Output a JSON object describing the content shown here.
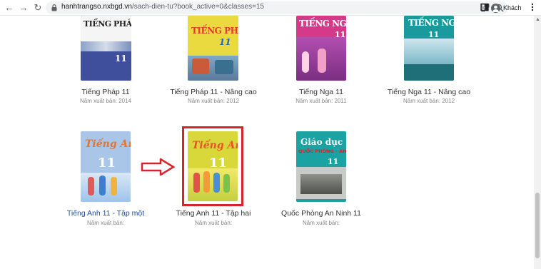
{
  "browser": {
    "url_host": "hanhtrangso.nxbgd.vn",
    "url_path": "/sach-dien-tu?book_active=0&classes=15",
    "profile_label": "Khách"
  },
  "books": [
    {
      "title": "Tiếng Pháp 11",
      "year": "Năm xuất bản: 2014",
      "cover_title": "TIẾNG PHÁP",
      "cover_num": "11"
    },
    {
      "title": "Tiếng Pháp 11 - Nâng cao",
      "year": "Năm xuất bản: 2012",
      "cover_title": "TIẾNG PHÁP",
      "cover_num": "11"
    },
    {
      "title": "Tiếng Nga 11",
      "year": "Năm xuất bản: 2011",
      "cover_title": "TIẾNG NGA",
      "cover_num": "11"
    },
    {
      "title": "Tiếng Nga 11 - Nâng cao",
      "year": "Năm xuất bản: 2012",
      "cover_title": "TIẾNG NGA",
      "cover_num": "11"
    },
    {
      "title": "Tiếng Anh 11 - Tập một",
      "year": "Năm xuất bản:",
      "cover_title": "Tiếng Anh",
      "cover_num": "11"
    },
    {
      "title": "Tiếng Anh 11 - Tập hai",
      "year": "Năm xuất bản:",
      "cover_title": "Tiếng Anh",
      "cover_num": "11"
    },
    {
      "title": "Quốc Phòng An Ninh 11",
      "year": "Năm xuất bản:",
      "cover_title": "Giáo dục",
      "cover_sub": "QUỐC PHÒNG - AN NINH",
      "cover_num": "11"
    }
  ],
  "colors": {
    "highlight": "#d9232b",
    "link_blue": "#1d4b9b"
  }
}
